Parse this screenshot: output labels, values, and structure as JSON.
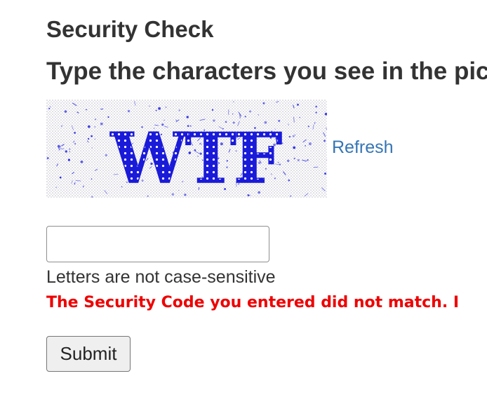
{
  "page": {
    "title": "Security Check",
    "instruction": "Type the characters you see in the pic"
  },
  "captcha": {
    "text": "WTF",
    "text_color": "#1a1ad9",
    "noise_color": "#2a2ae0",
    "background_color": "#e6e6ee"
  },
  "refresh": {
    "label": "Refresh",
    "color": "#3575b5"
  },
  "code_field": {
    "value": "",
    "placeholder": ""
  },
  "hint": {
    "text": "Letters are not case-sensitive"
  },
  "error": {
    "text": "The Security Code you entered did not match. I",
    "color": "#ee0000"
  },
  "submit": {
    "label": "Submit"
  }
}
